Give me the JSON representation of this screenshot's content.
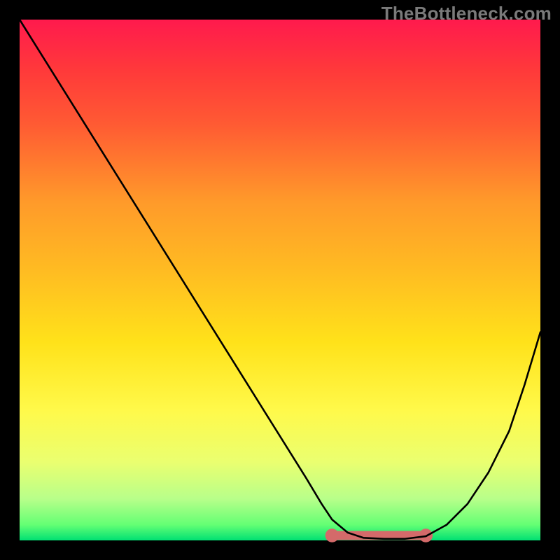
{
  "attribution": "TheBottleneck.com",
  "colors": {
    "gradient_top": "#ff1a4d",
    "gradient_bottom": "#00e073",
    "curve": "#000000",
    "marker": "#d46a6a",
    "frame": "#000000"
  },
  "chart_data": {
    "type": "line",
    "title": "",
    "xlabel": "",
    "ylabel": "",
    "xlim": [
      0,
      100
    ],
    "ylim": [
      0,
      100
    ],
    "series": [
      {
        "name": "bottleneck-curve",
        "x": [
          0,
          5,
          10,
          15,
          20,
          25,
          30,
          35,
          40,
          45,
          50,
          55,
          58,
          60,
          63,
          66,
          70,
          74,
          78,
          82,
          86,
          90,
          94,
          97,
          100
        ],
        "y": [
          100,
          92,
          84,
          76,
          68,
          60,
          52,
          44,
          36,
          28,
          20,
          12,
          7,
          4,
          1.5,
          0.5,
          0.3,
          0.3,
          0.8,
          3,
          7,
          13,
          21,
          30,
          40
        ]
      }
    ],
    "highlight": {
      "name": "optimal-range",
      "x_range": [
        60,
        78
      ],
      "y": 0,
      "color": "#d46a6a"
    }
  }
}
